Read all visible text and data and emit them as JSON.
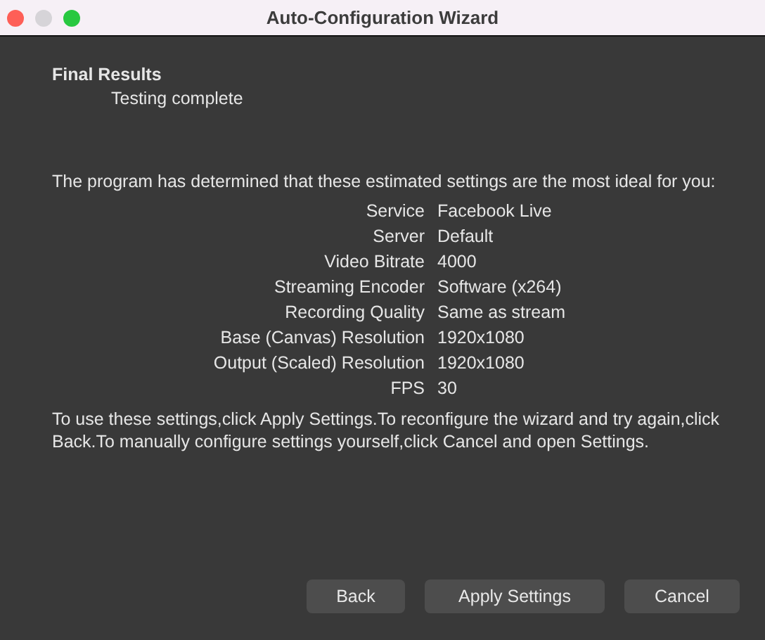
{
  "window": {
    "title": "Auto-Configuration Wizard"
  },
  "header": {
    "title": "Final Results",
    "subtitle": "Testing complete"
  },
  "intro": "The program has determined that these estimated settings are the most ideal for you:",
  "settings": [
    {
      "label": "Service",
      "value": "Facebook Live"
    },
    {
      "label": "Server",
      "value": "Default"
    },
    {
      "label": "Video Bitrate",
      "value": "4000"
    },
    {
      "label": "Streaming Encoder",
      "value": "Software (x264)"
    },
    {
      "label": "Recording Quality",
      "value": "Same as stream"
    },
    {
      "label": "Base (Canvas) Resolution",
      "value": "1920x1080"
    },
    {
      "label": "Output (Scaled) Resolution",
      "value": "1920x1080"
    },
    {
      "label": "FPS",
      "value": "30"
    }
  ],
  "note": "To use these settings,click Apply Settings.To reconfigure the wizard and try again,click Back.To manually configure settings yourself,click Cancel and open Settings.",
  "buttons": [
    "Back",
    "Apply Settings",
    "Cancel"
  ]
}
